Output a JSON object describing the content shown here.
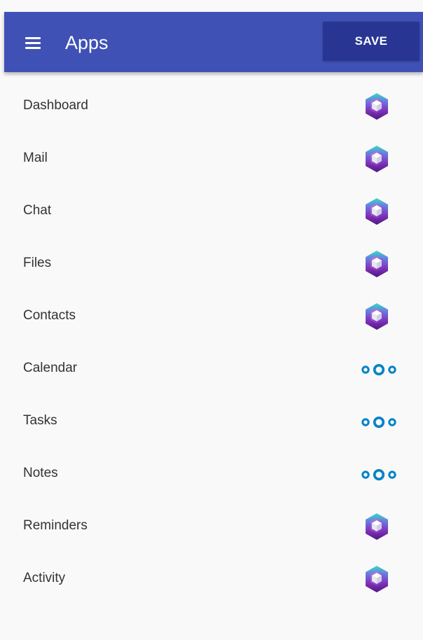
{
  "header": {
    "title": "Apps",
    "save_label": "SAVE",
    "menu_icon": "hamburger-menu-icon"
  },
  "colors": {
    "header_bg": "#3f51b5",
    "save_bg": "#283593",
    "ring_icon": "#0082c9",
    "hex_icon_purple": "#7a2fa8",
    "hex_icon_teal": "#33d7c6"
  },
  "apps": [
    {
      "label": "Dashboard",
      "icon": "hexagon-app-icon"
    },
    {
      "label": "Mail",
      "icon": "hexagon-app-icon"
    },
    {
      "label": "Chat",
      "icon": "hexagon-app-icon"
    },
    {
      "label": "Files",
      "icon": "hexagon-app-icon"
    },
    {
      "label": "Contacts",
      "icon": "hexagon-app-icon"
    },
    {
      "label": "Calendar",
      "icon": "rings-logo-icon"
    },
    {
      "label": "Tasks",
      "icon": "rings-logo-icon"
    },
    {
      "label": "Notes",
      "icon": "rings-logo-icon"
    },
    {
      "label": "Reminders",
      "icon": "hexagon-app-icon"
    },
    {
      "label": "Activity",
      "icon": "hexagon-app-icon"
    }
  ]
}
